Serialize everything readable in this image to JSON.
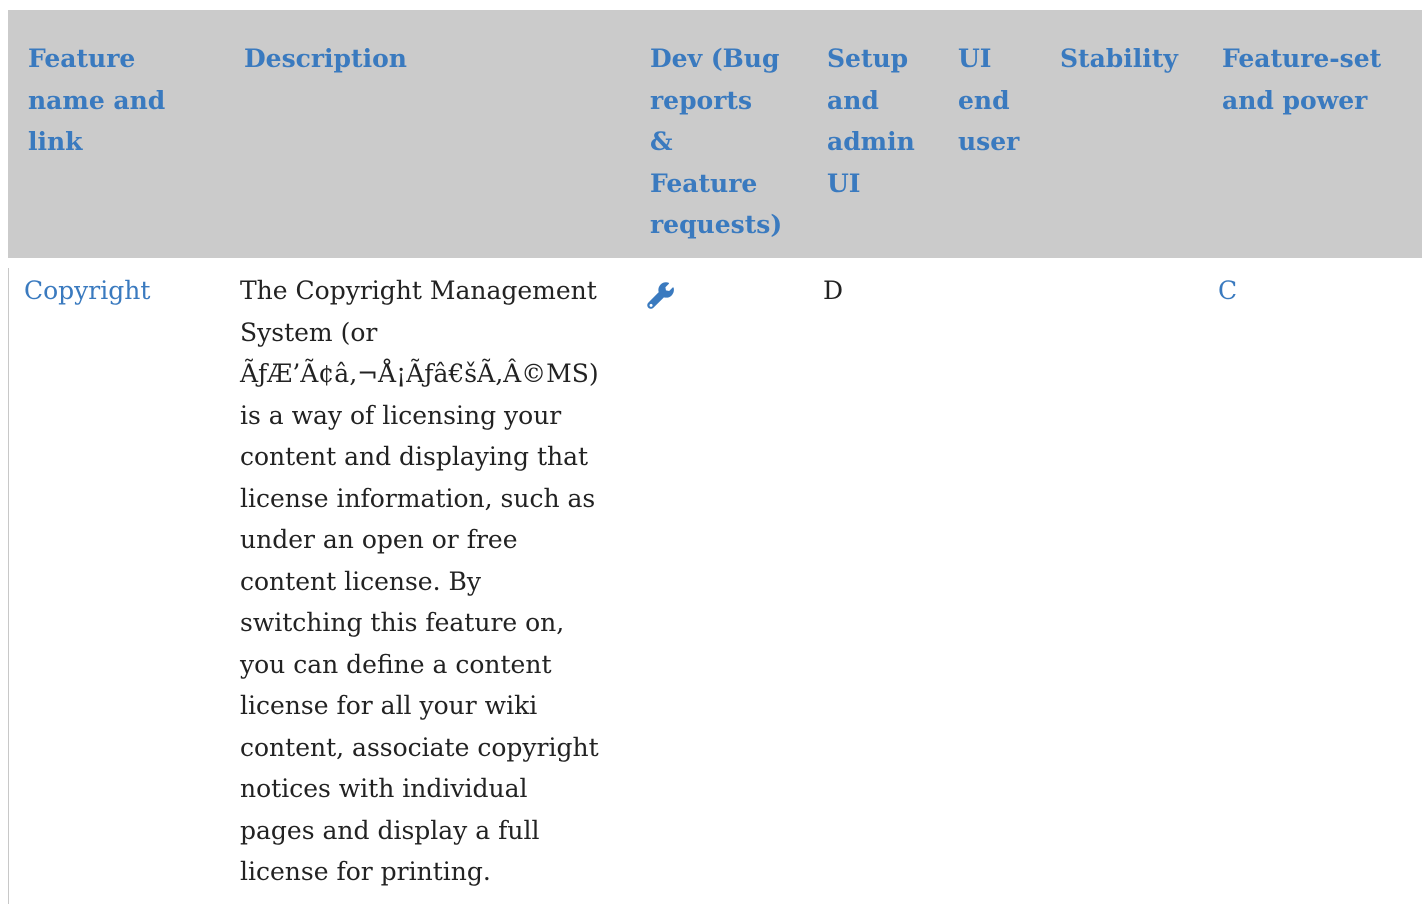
{
  "table": {
    "headers": {
      "feature": "Feature\nname and\nlink",
      "description": "Description",
      "dev": "Dev (Bug\nreports\n&\nFeature\nrequests)",
      "setup": "Setup\nand\nadmin\nUI",
      "ui": "UI\nend\nuser",
      "stability": "Stability",
      "featureset": "Feature-set\nand power"
    },
    "row": {
      "feature_link": "Copyright",
      "description_lines": [
        "The Copyright Management",
        "System (or",
        "ÃƒÆ’Ã¢â‚¬Å¡Ãƒâ€šÃ‚Â©MS)",
        "is a way of licensing your",
        "content and displaying that",
        "license information, such as",
        "under an open or free",
        "content license. By",
        "switching this feature on,",
        "you can define a content",
        "license for all your wiki",
        "content, associate copyright",
        "notices with individual",
        "pages and display a full",
        "license for printing."
      ],
      "dev_icon": "wrench-icon",
      "setup": "D",
      "ui": "",
      "stability": "",
      "featureset": "C"
    }
  },
  "colors": {
    "header_bg": "#cbcbcb",
    "link": "#3a7abf",
    "text": "#222222"
  }
}
